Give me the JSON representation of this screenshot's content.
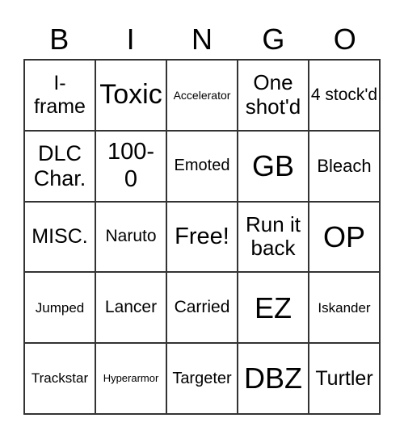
{
  "header": {
    "letters": [
      "B",
      "I",
      "N",
      "G",
      "O"
    ]
  },
  "cells": [
    [
      "I-\nframe",
      "Toxic",
      "Accelerator",
      "One shot'd",
      "4 stock'd"
    ],
    [
      "DLC Char.",
      "100-\n0",
      "Emoted",
      "GB",
      "Bleach"
    ],
    [
      "MISC.",
      "Naruto",
      "Free!",
      "Run it back",
      "OP"
    ],
    [
      "Jumped",
      "Lancer",
      "Carried",
      "EZ",
      "Iskander"
    ],
    [
      "Trackstar",
      "Hyperarmor",
      "Targeter",
      "DBZ",
      "Turtler"
    ]
  ]
}
